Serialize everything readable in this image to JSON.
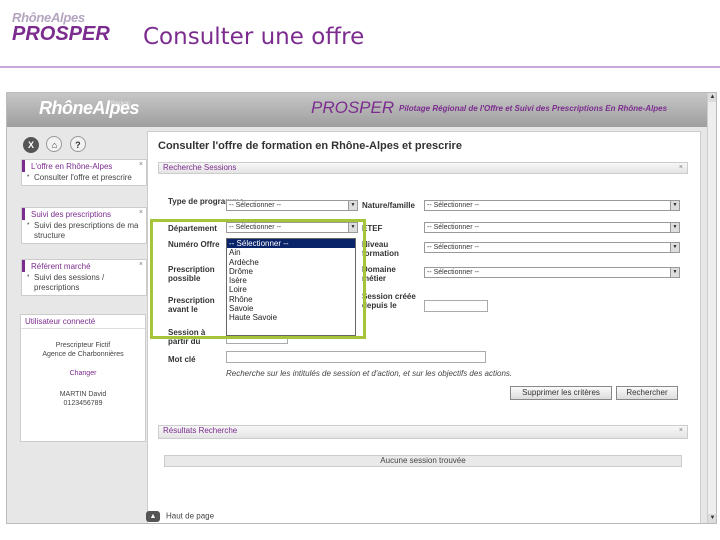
{
  "slide": {
    "logo_top": "RhôneAlpes",
    "logo_bottom": "PROSPER",
    "title": "Consulter une offre"
  },
  "banner": {
    "ra_logo": "RhôneAlpes",
    "ra_sub": "Région",
    "prosper": "PROSPER",
    "tagline": "Pilotage Régional de l'Offre et Suivi des Prescriptions En Rhône-Alpes"
  },
  "toolbar": {
    "close_glyph": "X",
    "home_glyph": "⌂",
    "help_glyph": "?"
  },
  "sidebar": {
    "boxes": [
      {
        "title": "L'offre en Rhône-Alpes",
        "close": "×",
        "links": [
          "Consulter l'offre et prescrire"
        ]
      },
      {
        "title": "Suivi des prescriptions",
        "close": "×",
        "links": [
          "Suivi des prescriptions de ma structure"
        ]
      },
      {
        "title": "Référent marché",
        "close": "×",
        "links": [
          "Suivi des sessions / prescriptions"
        ]
      }
    ],
    "user": {
      "title": "Utilisateur connecté",
      "name": "Prescripteur Fictif",
      "org": "Agence de Charbonnières",
      "change": "Changer",
      "person": "MARTIN David",
      "phone": "0123456789"
    }
  },
  "main": {
    "heading": "Consulter l'offre de formation en Rhône-Alpes et prescrire",
    "search_panel": "Recherche Sessions",
    "results_panel": "Résultats Recherche",
    "close_glyph": "×",
    "fields": {
      "type_programme": "Type de programme",
      "departement": "Département",
      "numero_offre": "Numéro Offre",
      "prescription_possible": "Prescription possible",
      "prescription_avant": "Prescription avant le",
      "session_partir": "Session à partir du",
      "mot_cle": "Mot clé",
      "nature_famille": "Nature/famille",
      "etef": "ETEF",
      "niveau_formation": "Niveau formation",
      "domaine_metier": "Domaine métier",
      "session_creee": "Session créée depuis le"
    },
    "select_placeholder": "-- Sélectionner --",
    "departement_options": [
      "-- Sélectionner --",
      "Ain",
      "Ardèche",
      "Drôme",
      "Isère",
      "Loire",
      "Rhône",
      "Savoie",
      "Haute Savoie"
    ],
    "search_hint": "Recherche sur les intitulés de session et d'action, et sur les objectifs des actions.",
    "btn_clear": "Supprimer les critères",
    "btn_search": "Rechercher",
    "no_results": "Aucune session trouvée"
  },
  "footer": {
    "back_top": "Haut de page"
  }
}
